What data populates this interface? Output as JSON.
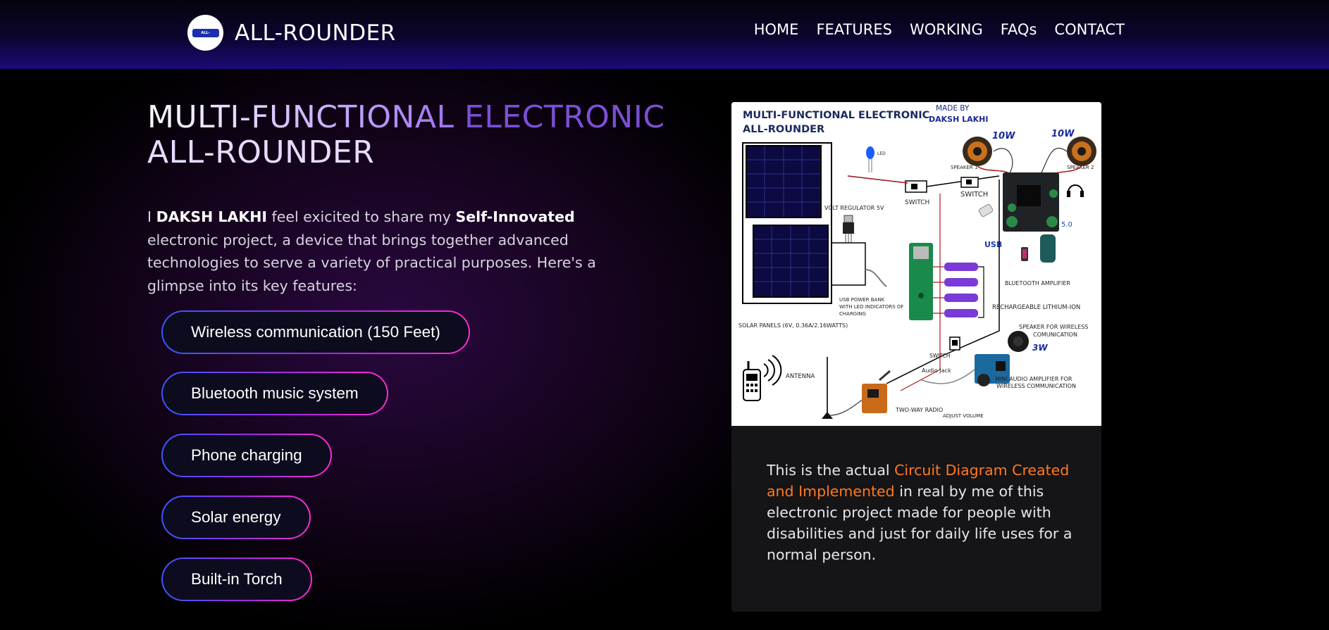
{
  "header": {
    "brand": "ALL-ROUNDER",
    "logo_text": "ALL-ROUNDER",
    "nav": [
      "HOME",
      "FEATURES",
      "WORKING",
      "FAQs",
      "CONTACT"
    ]
  },
  "hero": {
    "title_part1": "MULTI-FUNCTIONAL ",
    "title_part2": "ELECTRONIC",
    "title_line2": "ALL-ROUNDER",
    "intro": {
      "p1": "I ",
      "name": "DAKSH LAKHI",
      "p2": " feel exicited to share my ",
      "emph": "Self-Innovated",
      "p3": " electronic project, a device that brings together advanced technologies to serve a variety of practical purposes. Here's a glimpse into its key features:"
    }
  },
  "features": [
    "Wireless communication (150 Feet)",
    "Bluetooth music system",
    "Phone charging",
    "Solar energy",
    "Built-in Torch"
  ],
  "diagram": {
    "title_line1": "MULTI-FUNCTIONAL ELECTRONIC",
    "title_line2": "ALL-ROUNDER",
    "made_by_1": "MADE BY",
    "made_by_2": "DAKSH LAKHI",
    "labels": {
      "led": "LED",
      "volt_regulator": "VOLT REGULATOR 5V",
      "switch1": "SWITCH",
      "switch2": "SWITCH",
      "switch3": "SWITCH",
      "speaker1": "SPEAKER 1",
      "speaker2": "SPEAKER 2",
      "watt1": "10W",
      "watt2": "10W",
      "bt_version": "5.0",
      "usb": "USB",
      "bt_amp": "BLUETOOTH AMPLIFIER",
      "power_bank_1": "USB POWER BANK",
      "power_bank_2": "WITH LED INDICATORS OF",
      "power_bank_3": "CHARGING",
      "lithium": "RECHARGEABLE LITHIUM-ION",
      "solar": "SOLAR PANELS (6V, 0.36A/2.16WATTS)",
      "speaker_wireless_1": "SPEAKER FOR WIRELESS",
      "speaker_wireless_2": "COMUNICATION",
      "watt3": "3W",
      "antenna": "ANTENNA",
      "audio_jack": "Audio Jack",
      "mini_amp_1": "MINI AUDIO AMPLIFIER FOR",
      "mini_amp_2": "WIRELESS COMMUNICATION",
      "two_way": "TWO-WAY RADIO",
      "adjust": "ADJUST VOLUME"
    }
  },
  "caption": {
    "p1": "This is the actual ",
    "highlight": "Circuit Diagram Created and Implemented",
    "p2": " in real by me of this electronic project made for people with disabilities and just for daily life uses for a normal person."
  },
  "colors": {
    "accent_orange": "#ff7a1f",
    "pill_gradient_start": "#3a56ff",
    "pill_gradient_end": "#ff2bd0",
    "header_blue": "#1c0a78",
    "title_purple": "#7b4fd6"
  }
}
